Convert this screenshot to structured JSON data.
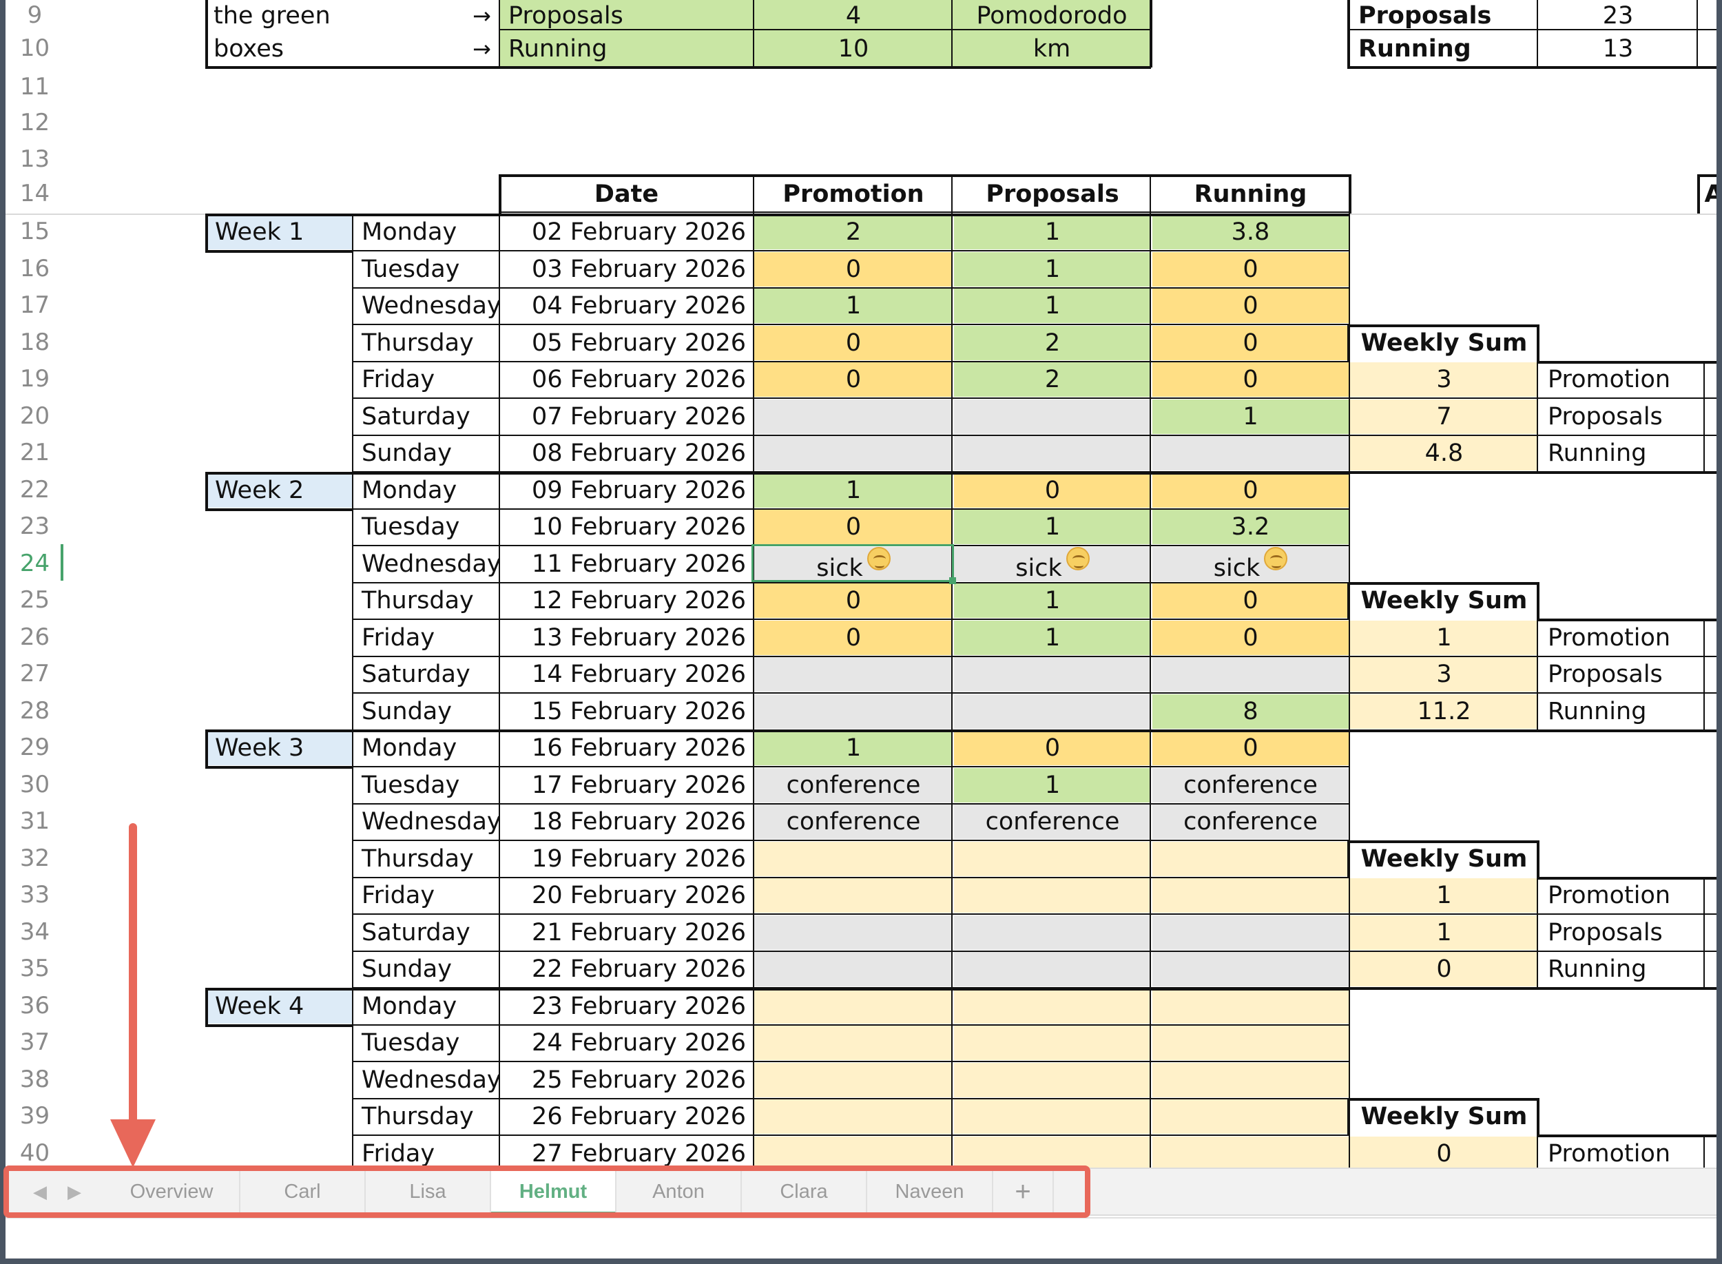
{
  "top_table": {
    "rows": [
      {
        "row": "9",
        "note": "the green",
        "arrow": "→",
        "label": "Proposals",
        "target": "4",
        "unit": "Pomodorodo"
      },
      {
        "row": "10",
        "note": "boxes",
        "arrow": "→",
        "label": "Running",
        "target": "10",
        "unit": "km"
      }
    ]
  },
  "totals_table": {
    "rows": [
      {
        "label": "Proposals",
        "value": "23"
      },
      {
        "label": "Running",
        "value": "13"
      }
    ]
  },
  "row_numbers": [
    "9",
    "10",
    "11",
    "12",
    "13",
    "14",
    "15",
    "16",
    "17",
    "18",
    "19",
    "20",
    "21",
    "22",
    "23",
    "24",
    "25",
    "26",
    "27",
    "28",
    "29",
    "30",
    "31",
    "32",
    "33",
    "34",
    "35",
    "36",
    "37",
    "38",
    "39",
    "40"
  ],
  "selected_row": "24",
  "header": {
    "date": "Date",
    "promotion": "Promotion",
    "proposals": "Proposals",
    "running": "Running",
    "col_cut": "A"
  },
  "weeks": [
    "Week 1",
    "Week 2",
    "Week 3",
    "Week 4"
  ],
  "days": [
    {
      "day": "Monday",
      "date": "02 February 2026",
      "promotion": "2",
      "proposals": "1",
      "running": "3.8"
    },
    {
      "day": "Tuesday",
      "date": "03 February 2026",
      "promotion": "0",
      "proposals": "1",
      "running": "0"
    },
    {
      "day": "Wednesday",
      "date": "04 February 2026",
      "promotion": "1",
      "proposals": "1",
      "running": "0"
    },
    {
      "day": "Thursday",
      "date": "05 February 2026",
      "promotion": "0",
      "proposals": "2",
      "running": "0"
    },
    {
      "day": "Friday",
      "date": "06 February 2026",
      "promotion": "0",
      "proposals": "2",
      "running": "0"
    },
    {
      "day": "Saturday",
      "date": "07 February 2026",
      "promotion": "",
      "proposals": "",
      "running": "1"
    },
    {
      "day": "Sunday",
      "date": "08 February 2026",
      "promotion": "",
      "proposals": "",
      "running": ""
    },
    {
      "day": "Monday",
      "date": "09 February 2026",
      "promotion": "1",
      "proposals": "0",
      "running": "0"
    },
    {
      "day": "Tuesday",
      "date": "10 February 2026",
      "promotion": "0",
      "proposals": "1",
      "running": "3.2"
    },
    {
      "day": "Wednesday",
      "date": "11 February 2026",
      "promotion": "sick",
      "proposals": "sick",
      "running": "sick"
    },
    {
      "day": "Thursday",
      "date": "12 February 2026",
      "promotion": "0",
      "proposals": "1",
      "running": "0"
    },
    {
      "day": "Friday",
      "date": "13 February 2026",
      "promotion": "0",
      "proposals": "1",
      "running": "0"
    },
    {
      "day": "Saturday",
      "date": "14 February 2026",
      "promotion": "",
      "proposals": "",
      "running": ""
    },
    {
      "day": "Sunday",
      "date": "15 February 2026",
      "promotion": "",
      "proposals": "",
      "running": "8"
    },
    {
      "day": "Monday",
      "date": "16 February 2026",
      "promotion": "1",
      "proposals": "0",
      "running": "0"
    },
    {
      "day": "Tuesday",
      "date": "17 February 2026",
      "promotion": "conference",
      "proposals": "1",
      "running": "conference"
    },
    {
      "day": "Wednesday",
      "date": "18 February 2026",
      "promotion": "conference",
      "proposals": "conference",
      "running": "conference"
    },
    {
      "day": "Thursday",
      "date": "19 February 2026",
      "promotion": "",
      "proposals": "",
      "running": ""
    },
    {
      "day": "Friday",
      "date": "20 February 2026",
      "promotion": "",
      "proposals": "",
      "running": ""
    },
    {
      "day": "Saturday",
      "date": "21 February 2026",
      "promotion": "",
      "proposals": "",
      "running": ""
    },
    {
      "day": "Sunday",
      "date": "22 February 2026",
      "promotion": "",
      "proposals": "",
      "running": ""
    },
    {
      "day": "Monday",
      "date": "23 February 2026",
      "promotion": "",
      "proposals": "",
      "running": ""
    },
    {
      "day": "Tuesday",
      "date": "24 February 2026",
      "promotion": "",
      "proposals": "",
      "running": ""
    },
    {
      "day": "Wednesday",
      "date": "25 February 2026",
      "promotion": "",
      "proposals": "",
      "running": ""
    },
    {
      "day": "Thursday",
      "date": "26 February 2026",
      "promotion": "",
      "proposals": "",
      "running": ""
    },
    {
      "day": "Friday",
      "date": "27 February 2026",
      "promotion": "",
      "proposals": "",
      "running": ""
    }
  ],
  "cell_colors": [
    [
      "green",
      "green",
      "green"
    ],
    [
      "orange",
      "green",
      "orange"
    ],
    [
      "green",
      "green",
      "orange"
    ],
    [
      "orange",
      "green",
      "orange"
    ],
    [
      "orange",
      "green",
      "orange"
    ],
    [
      "grey",
      "grey",
      "green"
    ],
    [
      "grey",
      "grey",
      "grey"
    ],
    [
      "green",
      "orange",
      "orange"
    ],
    [
      "orange",
      "green",
      "green"
    ],
    [
      "grey",
      "grey",
      "grey"
    ],
    [
      "orange",
      "green",
      "orange"
    ],
    [
      "orange",
      "green",
      "orange"
    ],
    [
      "grey",
      "grey",
      "grey"
    ],
    [
      "grey",
      "grey",
      "green"
    ],
    [
      "green",
      "orange",
      "orange"
    ],
    [
      "grey",
      "green",
      "grey"
    ],
    [
      "grey",
      "grey",
      "grey"
    ],
    [
      "cream",
      "cream",
      "cream"
    ],
    [
      "cream",
      "cream",
      "cream"
    ],
    [
      "grey",
      "grey",
      "grey"
    ],
    [
      "grey",
      "grey",
      "grey"
    ],
    [
      "cream",
      "cream",
      "cream"
    ],
    [
      "cream",
      "cream",
      "cream"
    ],
    [
      "cream",
      "cream",
      "cream"
    ],
    [
      "cream",
      "cream",
      "cream"
    ],
    [
      "cream",
      "cream",
      "cream"
    ]
  ],
  "weekly_sums": [
    {
      "title": "Weekly Sum",
      "items": [
        {
          "value": "3",
          "label": "Promotion"
        },
        {
          "value": "7",
          "label": "Proposals"
        },
        {
          "value": "4.8",
          "label": "Running"
        }
      ]
    },
    {
      "title": "Weekly Sum",
      "items": [
        {
          "value": "1",
          "label": "Promotion"
        },
        {
          "value": "3",
          "label": "Proposals"
        },
        {
          "value": "11.2",
          "label": "Running"
        }
      ]
    },
    {
      "title": "Weekly Sum",
      "items": [
        {
          "value": "1",
          "label": "Promotion"
        },
        {
          "value": "1",
          "label": "Proposals"
        },
        {
          "value": "0",
          "label": "Running"
        }
      ]
    },
    {
      "title": "Weekly Sum",
      "items": [
        {
          "value": "0",
          "label": "Promotion"
        }
      ]
    }
  ],
  "tabs": {
    "items": [
      "Overview",
      "Carl",
      "Lisa",
      "Helmut",
      "Anton",
      "Clara",
      "Naveen"
    ],
    "active": "Helmut",
    "add": "+",
    "prev": "◀",
    "next": "▶"
  },
  "colors": {
    "green": "#c9e6a4",
    "orange": "#ffdf85",
    "grey": "#e6e6e6",
    "cream": "#fff1c9",
    "week_label": "#ddebf7",
    "annotation": "#e8685a",
    "active_tab": "#62b083"
  }
}
